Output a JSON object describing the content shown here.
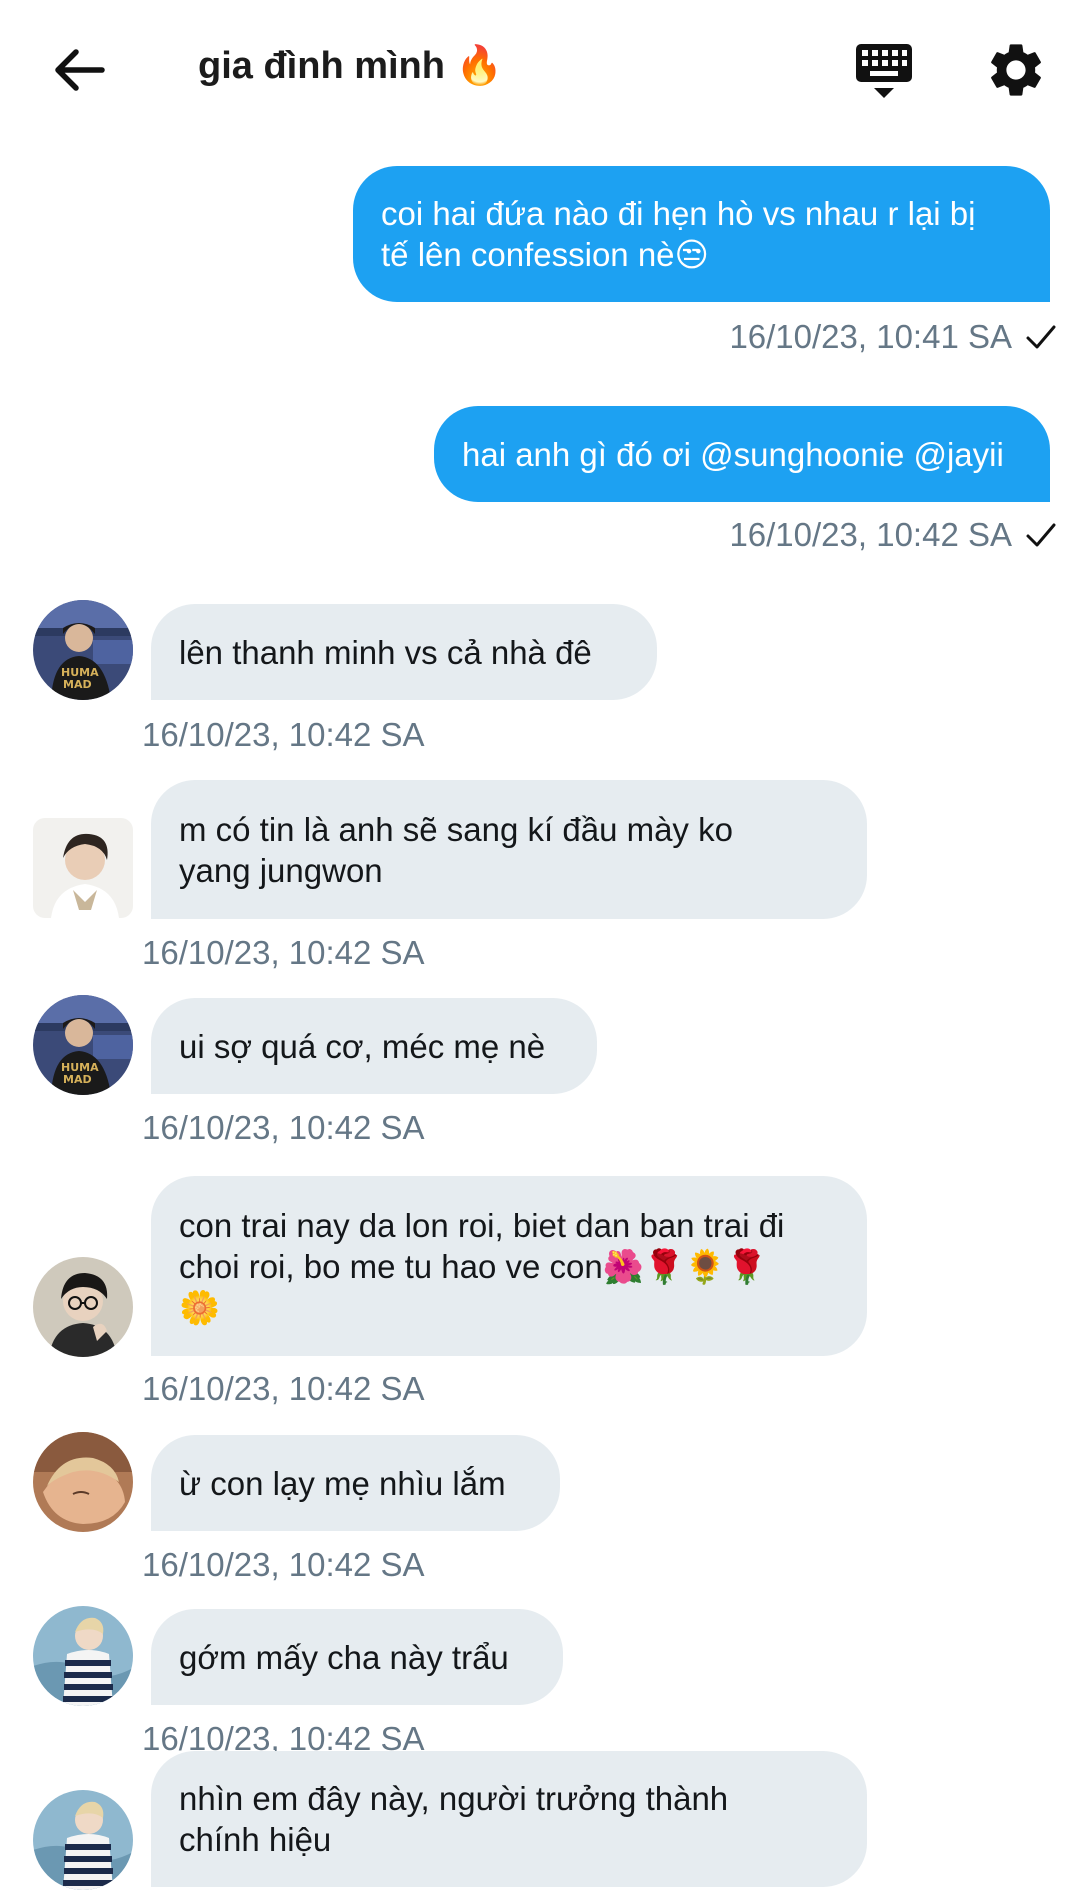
{
  "header": {
    "title": "gia đình mình 🔥",
    "back_icon": "arrow-left-icon",
    "keyboard_icon": "keyboard-icon",
    "settings_icon": "gear-icon"
  },
  "colors": {
    "outgoing_bubble": "#1da1f2",
    "incoming_bubble": "#e6ecf0",
    "timestamp": "#657786"
  },
  "messages": [
    {
      "direction": "out",
      "text": "coi hai đứa nào đi hẹn hò vs nhau r lại bị\ntế lên confession nè😒",
      "timestamp": "16/10/23, 10:41 SA",
      "read": true
    },
    {
      "direction": "out",
      "text": "hai anh gì đó ơi @sunghoonie @jayii",
      "timestamp": "16/10/23, 10:42 SA",
      "read": true
    },
    {
      "direction": "in",
      "text": "lên thanh minh vs cả nhà đê",
      "timestamp": "16/10/23, 10:42 SA"
    },
    {
      "direction": "in",
      "text": "m có tin là anh sẽ sang kí đầu mày ko\nyang jungwon",
      "timestamp": "16/10/23, 10:42 SA"
    },
    {
      "direction": "in",
      "text": "ui sợ quá cơ, méc mẹ nè",
      "timestamp": "16/10/23, 10:42 SA"
    },
    {
      "direction": "in",
      "text": "con trai nay da lon roi, biet dan ban trai đi\nchoi roi, bo me tu hao ve con🌺🌹🌻🌹\n🌼",
      "timestamp": "16/10/23, 10:42 SA"
    },
    {
      "direction": "in",
      "text": "ừ con lạy mẹ nhìu lắm",
      "timestamp": "16/10/23, 10:42 SA"
    },
    {
      "direction": "in",
      "text": "gớm mấy cha này trẩu",
      "timestamp": "16/10/23, 10:42 SA"
    },
    {
      "direction": "in",
      "text": "nhìn em đây này, người trưởng thành\nchính hiệu",
      "timestamp": ""
    }
  ]
}
